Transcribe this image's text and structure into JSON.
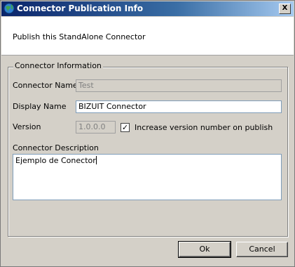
{
  "window": {
    "title": "Connector Publication Info",
    "close_label": "X"
  },
  "header": {
    "text": "Publish this StandAlone Connector"
  },
  "group": {
    "label": "Connector Information",
    "connector_name_label": "Connector Name",
    "connector_name_value": "Test",
    "display_name_label": "Display Name",
    "display_name_value": "BIZUIT Connector",
    "version_label": "Version",
    "version_value": "1.0.0.0",
    "increase_version_checked": true,
    "increase_version_label": "Increase version number on publish",
    "description_label": "Connector Description",
    "description_value": "Ejemplo de Conector"
  },
  "buttons": {
    "ok_label": "Ok",
    "cancel_label": "Cancel"
  }
}
